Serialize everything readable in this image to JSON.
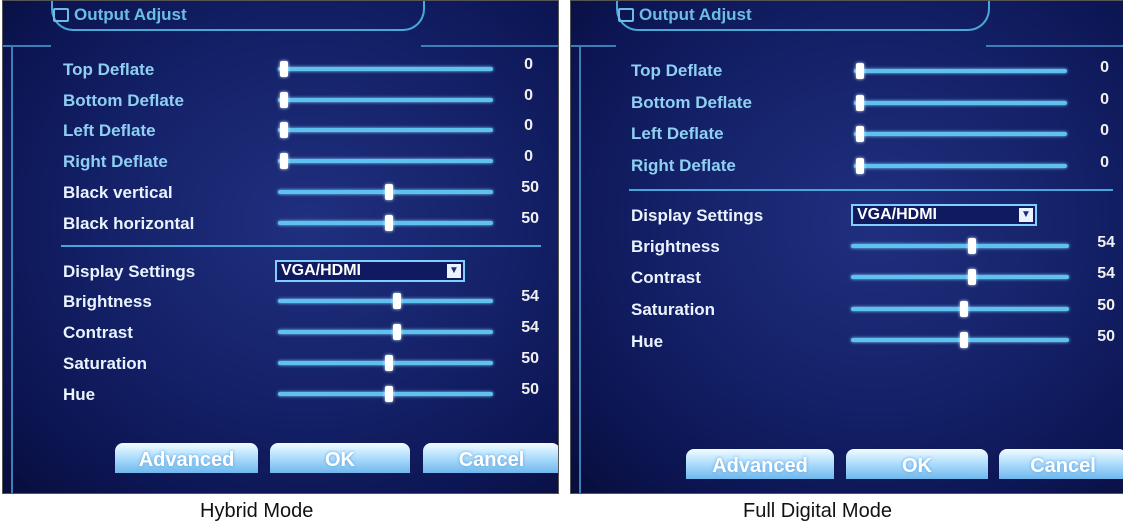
{
  "panels": [
    {
      "title": "Output Adjust",
      "caption": "Hybrid Mode",
      "deflate_rows": [
        {
          "label": "Top Deflate",
          "value": "0",
          "level": 0
        },
        {
          "label": "Bottom Deflate",
          "value": "0",
          "level": 0
        },
        {
          "label": "Left Deflate",
          "value": "0",
          "level": 0
        },
        {
          "label": "Right Deflate",
          "value": "0",
          "level": 0
        },
        {
          "label": "Black vertical",
          "value": "50",
          "level": 0.5
        },
        {
          "label": "Black horizontal",
          "value": "50",
          "level": 0.5
        }
      ],
      "display_settings": {
        "label": "Display Settings",
        "value": "VGA/HDMI"
      },
      "image_rows": [
        {
          "label": "Brightness",
          "value": "54",
          "level": 0.54
        },
        {
          "label": "Contrast",
          "value": "54",
          "level": 0.54
        },
        {
          "label": "Saturation",
          "value": "50",
          "level": 0.5
        },
        {
          "label": "Hue",
          "value": "50",
          "level": 0.5
        }
      ],
      "buttons": {
        "advanced": "Advanced",
        "ok": "OK",
        "cancel": "Cancel"
      }
    },
    {
      "title": "Output Adjust",
      "caption": "Full Digital Mode",
      "deflate_rows": [
        {
          "label": "Top Deflate",
          "value": "0",
          "level": 0
        },
        {
          "label": "Bottom Deflate",
          "value": "0",
          "level": 0
        },
        {
          "label": "Left Deflate",
          "value": "0",
          "level": 0
        },
        {
          "label": "Right Deflate",
          "value": "0",
          "level": 0
        }
      ],
      "display_settings": {
        "label": "Display Settings",
        "value": "VGA/HDMI"
      },
      "image_rows": [
        {
          "label": "Brightness",
          "value": "54",
          "level": 0.54
        },
        {
          "label": "Contrast",
          "value": "54",
          "level": 0.54
        },
        {
          "label": "Saturation",
          "value": "50",
          "level": 0.5
        },
        {
          "label": "Hue",
          "value": "50",
          "level": 0.5
        }
      ],
      "buttons": {
        "advanced": "Advanced",
        "ok": "OK",
        "cancel": "Cancel"
      }
    }
  ]
}
